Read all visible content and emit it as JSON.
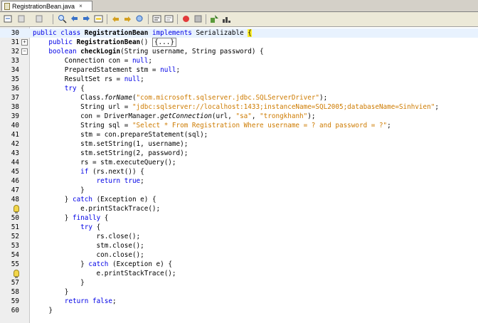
{
  "tab": {
    "label": "RegistrationBean.java",
    "close_glyph": "×"
  },
  "toolbar": {
    "icons": [
      "last-edit-icon",
      "back-icon",
      "forward-icon",
      "find-selection-icon",
      "find-previous-icon",
      "find-next-icon",
      "toggle-highlight-icon",
      "shift-left-icon",
      "shift-right-icon",
      "comment-icon",
      "uncomment-icon",
      "start-macro-icon",
      "stop-macro-icon",
      "run-icon",
      "graph-icon"
    ]
  },
  "editor": {
    "lines": [
      {
        "n": "30",
        "s": [
          [
            "kw",
            "public "
          ],
          [
            "kw",
            "class "
          ],
          [
            "b",
            "RegistrationBean "
          ],
          [
            "kw",
            "implements "
          ],
          [
            "",
            "Serializable "
          ],
          [
            "brace-hl",
            "{"
          ]
        ]
      },
      {
        "n": "31",
        "s": [
          [
            "",
            "    "
          ],
          [
            "kw",
            "public "
          ],
          [
            "b",
            "RegistrationBean"
          ],
          [
            "",
            "() "
          ],
          [
            "collapsed",
            "{...}"
          ]
        ]
      },
      {
        "n": "32",
        "s": [
          [
            "",
            "    "
          ],
          [
            "kw",
            "boolean "
          ],
          [
            "b",
            "checkLogin"
          ],
          [
            "",
            "(String username, String password) {"
          ]
        ]
      },
      {
        "n": "33",
        "s": [
          [
            "",
            "        Connection con = "
          ],
          [
            "kw",
            "null"
          ],
          [
            "",
            ";"
          ]
        ]
      },
      {
        "n": "34",
        "s": [
          [
            "",
            "        PreparedStatement stm = "
          ],
          [
            "kw",
            "null"
          ],
          [
            "",
            ";"
          ]
        ]
      },
      {
        "n": "35",
        "s": [
          [
            "",
            "        ResultSet rs = "
          ],
          [
            "kw",
            "null"
          ],
          [
            "",
            ";"
          ]
        ]
      },
      {
        "n": "36",
        "s": [
          [
            "",
            "        "
          ],
          [
            "kw",
            "try"
          ],
          [
            "",
            " {"
          ]
        ]
      },
      {
        "n": "37",
        "s": [
          [
            "",
            "            Class."
          ],
          [
            "it",
            "forName"
          ],
          [
            "",
            "("
          ],
          [
            "str",
            "\"com.microsoft.sqlserver.jdbc.SQLServerDriver\""
          ],
          [
            "",
            ");"
          ]
        ]
      },
      {
        "n": "38",
        "s": [
          [
            "",
            "            String url = "
          ],
          [
            "str",
            "\"jdbc:sqlserver://localhost:1433;instanceName=SQL2005;databaseName=Sinhvien\""
          ],
          [
            "",
            ";"
          ]
        ]
      },
      {
        "n": "39",
        "s": [
          [
            "",
            "            con = DriverManager."
          ],
          [
            "it",
            "getConnection"
          ],
          [
            "",
            "(url, "
          ],
          [
            "str",
            "\"sa\""
          ],
          [
            "",
            ", "
          ],
          [
            "str",
            "\"trongkhanh\""
          ],
          [
            "",
            ");"
          ]
        ]
      },
      {
        "n": "40",
        "s": [
          [
            "",
            "            String sql = "
          ],
          [
            "str",
            "\"Select * From Registration Where username = ? and password = ?\""
          ],
          [
            "",
            ";"
          ]
        ]
      },
      {
        "n": "41",
        "s": [
          [
            "",
            "            stm = con.prepareStatement(sql);"
          ]
        ]
      },
      {
        "n": "42",
        "s": [
          [
            "",
            "            stm.setString(1, username);"
          ]
        ]
      },
      {
        "n": "43",
        "s": [
          [
            "",
            "            stm.setString(2, password);"
          ]
        ]
      },
      {
        "n": "44",
        "s": [
          [
            "",
            "            rs = stm.executeQuery();"
          ]
        ]
      },
      {
        "n": "45",
        "s": [
          [
            "",
            "            "
          ],
          [
            "kw",
            "if"
          ],
          [
            "",
            " (rs.next()) {"
          ]
        ]
      },
      {
        "n": "46",
        "s": [
          [
            "",
            "                "
          ],
          [
            "kw",
            "return "
          ],
          [
            "kw",
            "true"
          ],
          [
            "",
            ";"
          ]
        ]
      },
      {
        "n": "47",
        "s": [
          [
            "",
            "            }"
          ]
        ]
      },
      {
        "n": "48",
        "s": [
          [
            "",
            "        } "
          ],
          [
            "kw",
            "catch"
          ],
          [
            "",
            " (Exception e) {"
          ]
        ]
      },
      {
        "n": "",
        "s": [
          [
            "",
            "            e.printStackTrace();"
          ]
        ]
      },
      {
        "n": "50",
        "s": [
          [
            "",
            "        } "
          ],
          [
            "kw",
            "finally"
          ],
          [
            "",
            " {"
          ]
        ]
      },
      {
        "n": "51",
        "s": [
          [
            "",
            "            "
          ],
          [
            "kw",
            "try"
          ],
          [
            "",
            " {"
          ]
        ]
      },
      {
        "n": "52",
        "s": [
          [
            "",
            "                rs.close();"
          ]
        ]
      },
      {
        "n": "53",
        "s": [
          [
            "",
            "                stm.close();"
          ]
        ]
      },
      {
        "n": "54",
        "s": [
          [
            "",
            "                con.close();"
          ]
        ]
      },
      {
        "n": "55",
        "s": [
          [
            "",
            "            } "
          ],
          [
            "kw",
            "catch"
          ],
          [
            "",
            " (Exception e) {"
          ]
        ]
      },
      {
        "n": "",
        "s": [
          [
            "",
            "                e.printStackTrace();"
          ]
        ]
      },
      {
        "n": "57",
        "s": [
          [
            "",
            "            }"
          ]
        ]
      },
      {
        "n": "58",
        "s": [
          [
            "",
            "        }"
          ]
        ]
      },
      {
        "n": "59",
        "s": [
          [
            "",
            "        "
          ],
          [
            "kw",
            "return "
          ],
          [
            "kw",
            "false"
          ],
          [
            "",
            ";"
          ]
        ]
      },
      {
        "n": "60",
        "s": [
          [
            "",
            "    }"
          ]
        ]
      }
    ],
    "folds": {
      "31": "+",
      "32": "−"
    },
    "bulbs": [
      19,
      26
    ]
  }
}
